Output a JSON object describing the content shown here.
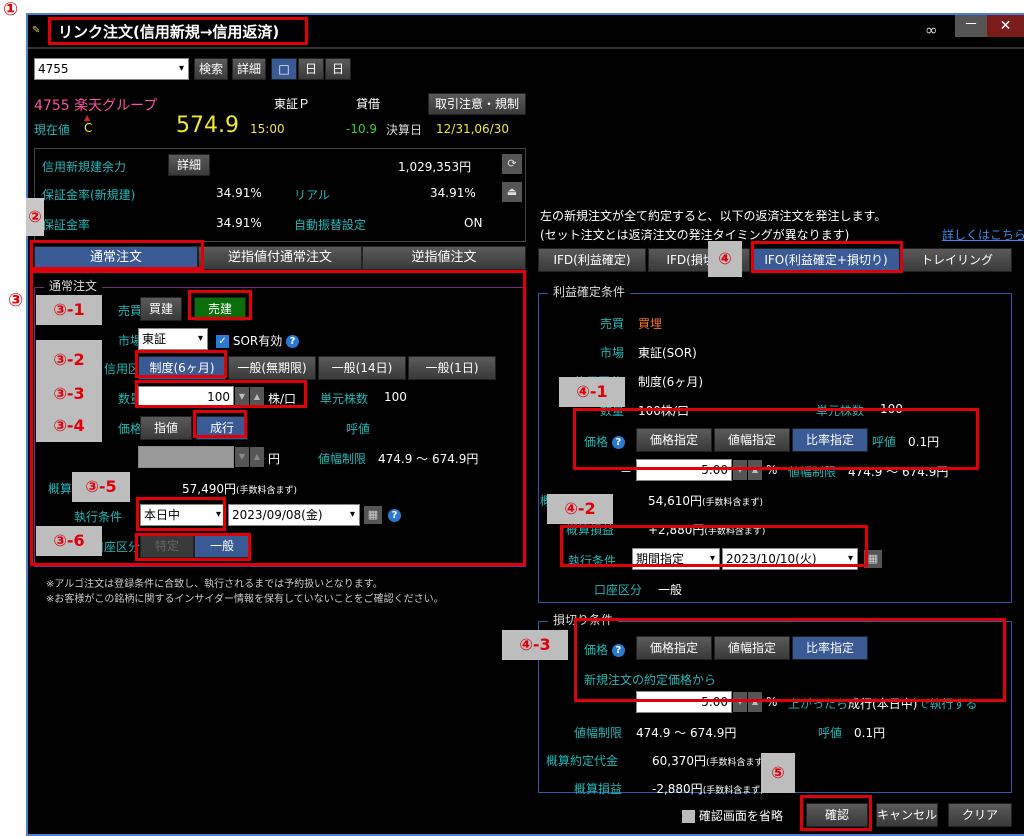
{
  "window": {
    "title": "リンク注文(信用新規→信用返済)",
    "link_icon": "chain-link-icon",
    "minimize": "－",
    "close": "✕"
  },
  "search": {
    "symbol_value": "4755",
    "search_btn": "検索",
    "detail_btn": "詳細",
    "layout_buttons": [
      "□",
      "日",
      "日"
    ]
  },
  "stock": {
    "code_name": "4755 楽天グループ",
    "market": "東証Ｐ",
    "margin_type": "貸借",
    "regulation_btn": "取引注意・規制",
    "price_label": "現在値",
    "price_flag": "C",
    "price": "574.9",
    "time": "15:00",
    "change": "-10.9",
    "settlement_label": "決算日",
    "settlement": "12/31,06/30"
  },
  "account": {
    "capacity_label": "信用新規建余力",
    "detail_btn": "詳細",
    "capacity_value": "1,029,353円",
    "margin_rate_new_label": "保証金率(新規建)",
    "margin_rate_new": "34.91%",
    "real_label": "リアル",
    "real_value": "34.91%",
    "margin_rate_label": "保証金率",
    "margin_rate": "34.91%",
    "auto_transfer_label": "自動振替設定",
    "auto_transfer": "ON"
  },
  "order_tabs": [
    "通常注文",
    "逆指値付通常注文",
    "逆指値注文"
  ],
  "order": {
    "legend": "通常注文",
    "side_label": "売買",
    "side_options": [
      "買建",
      "売建"
    ],
    "side_selected": "売建",
    "market_label": "市場",
    "market_value": "東証",
    "sor_label": "SOR有効",
    "sor_checked": true,
    "credit_label": "信用区分",
    "credit_options": [
      "制度(6ヶ月)",
      "一般(無期限)",
      "一般(14日)",
      "一般(1日)"
    ],
    "credit_selected": "制度(6ヶ月)",
    "qty_label": "数量",
    "qty_value": "100",
    "qty_unit": "株/口",
    "unit_shares_label": "単元株数",
    "unit_shares": "100",
    "price_label": "価格",
    "price_options": [
      "指値",
      "成行"
    ],
    "price_selected": "成行",
    "tick_label": "呼値",
    "price_value": "",
    "price_unit": "円",
    "limit_label": "値幅制限",
    "limit_value": "474.9 ～ 674.9円",
    "est_label": "概算約定代金",
    "est_value": "57,490円",
    "fee_note": "(手数料含まず)",
    "exec_label": "執行条件",
    "exec_value": "本日中",
    "exec_date": "2023/09/08(金)",
    "account_label": "口座区分",
    "account_options": [
      "特定",
      "一般"
    ],
    "account_selected": "一般"
  },
  "notes": [
    "※アルゴ注文は登録条件に合致し、執行されるまでは予約扱いとなります。",
    "※お客様がこの銘柄に関するインサイダー情報を保有していないことをご確認ください。"
  ],
  "right": {
    "info_line1": "左の新規注文が全て約定すると、以下の返済注文を発注します。",
    "info_line2": "(セット注文とは返済注文の発注タイミングが異なります)",
    "details_link": "詳しくはこちら",
    "tabs": [
      "IFD(利益確定)",
      "IFD(損切り)",
      "IFO(利益確定+損切り)",
      "トレイリング"
    ],
    "tab_selected": "IFO(利益確定+損切り)"
  },
  "profit": {
    "legend": "利益確定条件",
    "side_label": "売買",
    "side_value": "買埋",
    "market_label": "市場",
    "market_value": "東証(SOR)",
    "credit_label": "信用区分",
    "credit_value": "制度(6ヶ月)",
    "qty_label": "数量",
    "qty_value": "100株/口",
    "unit_label": "単元株数",
    "unit_value": "100",
    "price_label": "価格",
    "price_modes": [
      "価格指定",
      "値幅指定",
      "比率指定"
    ],
    "price_mode_selected": "比率指定",
    "tick_label": "呼値",
    "tick_value": "0.1円",
    "sign": "－",
    "ratio_value": "5.00",
    "ratio_unit": "%",
    "limit_label": "値幅制限",
    "limit_value": "474.9 ～ 674.9円",
    "est_label": "概算約定代金",
    "est_value": "54,610円",
    "pl_label": "概算損益",
    "pl_value": "+2,880円",
    "fee_note": "(手数料含まず)",
    "exec_label": "執行条件",
    "exec_value": "期間指定",
    "exec_date": "2023/10/10(火)",
    "account_label": "口座区分",
    "account_value": "一般"
  },
  "loss": {
    "legend": "損切り条件",
    "price_label": "価格",
    "price_modes": [
      "価格指定",
      "値幅指定",
      "比率指定"
    ],
    "price_mode_selected": "比率指定",
    "from_label": "新規注文の約定価格から",
    "ratio_value": "5.00",
    "ratio_unit": "%",
    "trigger_text_a": "上がったら",
    "trigger_text_b": "成行(本日中)",
    "trigger_text_c": "で執行する",
    "limit_label": "値幅制限",
    "limit_value": "474.9 ～ 674.9円",
    "tick_label": "呼値",
    "tick_value": "0.1円",
    "est_label": "概算約定代金",
    "est_value": "60,370円",
    "pl_label": "概算損益",
    "pl_value": "-2,880円",
    "fee_note": "(手数料含まず)"
  },
  "footer": {
    "skip_confirm_label": "確認画面を省略",
    "skip_confirm_checked": false,
    "confirm_btn": "確認",
    "cancel_btn": "キャンセル",
    "clear_btn": "クリア"
  },
  "annotations": {
    "m1": "①",
    "m2": "②",
    "m3": "③",
    "m3_1": "③-1",
    "m3_2": "③-2",
    "m3_3": "③-3",
    "m3_4": "③-4",
    "m3_5": "③-5",
    "m3_6": "③-6",
    "m4": "④",
    "m4_1": "④-1",
    "m4_2": "④-2",
    "m4_3": "④-3",
    "m5": "⑤"
  },
  "colors": {
    "accent_selected": "#3a5a95",
    "sell_green": "#0a6e0a",
    "label_cyan": "#1fb7b7",
    "price_yellow": "#f0e830",
    "annotation_red": "#e0000a"
  }
}
